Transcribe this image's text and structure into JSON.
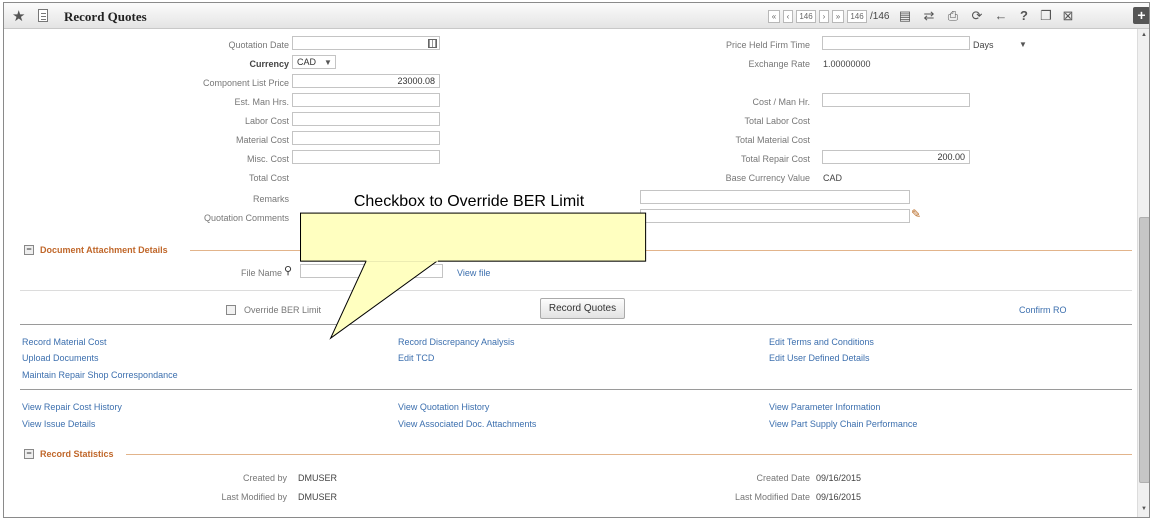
{
  "window": {
    "title": "Record Quotes",
    "pager": {
      "first": "«",
      "prev": "‹",
      "current": "146",
      "next": "›",
      "last": "»",
      "goto": "146",
      "total": "/146"
    }
  },
  "form": {
    "quotation_date_label": "Quotation Date",
    "quotation_date_value": "",
    "currency_label": "Currency",
    "currency_value": "CAD",
    "component_list_price_label": "Component List Price",
    "component_list_price_value": "23000.08",
    "est_man_hrs_label": "Est. Man Hrs.",
    "est_man_hrs_value": "",
    "labor_cost_label": "Labor Cost",
    "labor_cost_value": "",
    "material_cost_label": "Material Cost",
    "material_cost_value": "",
    "misc_cost_label": "Misc. Cost",
    "misc_cost_value": "",
    "total_cost_label": "Total Cost",
    "remarks_label": "Remarks",
    "quotation_comments_label": "Quotation Comments",
    "price_held_firm_time_label": "Price Held Firm Time",
    "price_held_firm_time_value": "",
    "price_held_unit": "Days",
    "exchange_rate_label": "Exchange Rate",
    "exchange_rate_value": "1.00000000",
    "cost_per_man_hr_label": "Cost / Man Hr.",
    "cost_per_man_hr_value": "",
    "total_labor_cost_label": "Total Labor Cost",
    "total_material_cost_label": "Total Material Cost",
    "total_repair_cost_label": "Total Repair Cost",
    "total_repair_cost_value": "200.00",
    "base_currency_value_label": "Base Currency Value",
    "base_currency_value_value": "CAD"
  },
  "attachments": {
    "section_title": "Document Attachment Details",
    "file_name_label": "File Name",
    "file_name_value": "",
    "view_file": "View file"
  },
  "actions": {
    "override_ber_label": "Override BER Limit",
    "record_quotes_button": "Record Quotes",
    "confirm_ro": "Confirm RO"
  },
  "links": {
    "row1": [
      "Record Material Cost",
      "Record Discrepancy Analysis",
      "Edit Terms and Conditions"
    ],
    "row2": [
      "Upload Documents",
      "Edit TCD",
      "Edit User Defined Details"
    ],
    "row3": [
      "Maintain Repair Shop Correspondance"
    ],
    "row4": [
      "View Repair Cost History",
      "View Quotation History",
      "View Parameter Information"
    ],
    "row5": [
      "View Issue Details",
      "View Associated Doc. Attachments",
      "View Part Supply Chain Performance"
    ]
  },
  "statistics": {
    "section_title": "Record Statistics",
    "created_by_label": "Created by",
    "created_by_value": "DMUSER",
    "last_modified_by_label": "Last Modified by",
    "last_modified_by_value": "DMUSER",
    "created_date_label": "Created Date",
    "created_date_value": "09/16/2015",
    "last_modified_date_label": "Last Modified Date",
    "last_modified_date_value": "09/16/2015"
  },
  "callout": {
    "text": "Checkbox to Override BER Limit",
    "fill": "#ffffc0"
  },
  "colors": {
    "section_header": "#c0672a",
    "link": "#3c6fae"
  },
  "icons": [
    "star-icon",
    "document-icon",
    "calendar-icon",
    "search-icon",
    "edit-comments-icon",
    "help-icon",
    "print-icon",
    "back-icon",
    "grid-icon",
    "collapse-icon"
  ]
}
